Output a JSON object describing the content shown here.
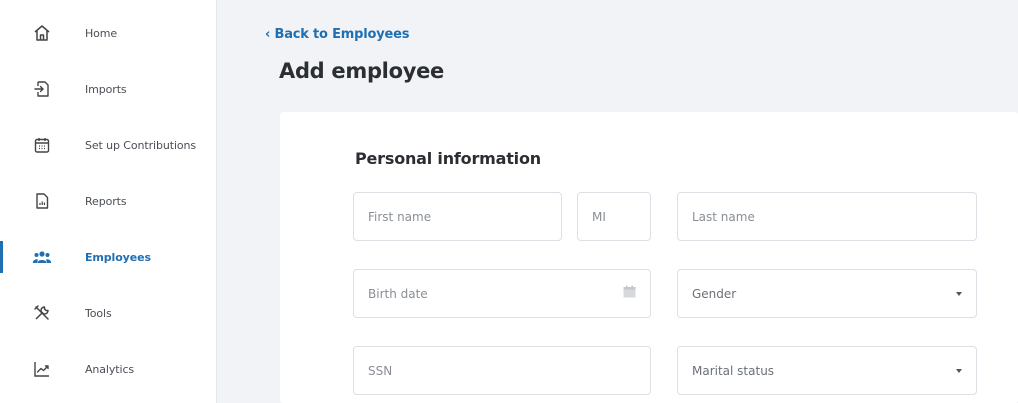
{
  "sidebar": {
    "items": [
      {
        "label": "Home",
        "icon": "home-icon",
        "active": false
      },
      {
        "label": "Imports",
        "icon": "import-icon",
        "active": false
      },
      {
        "label": "Set up Contributions",
        "icon": "calendar-icon",
        "active": false
      },
      {
        "label": "Reports",
        "icon": "report-icon",
        "active": false
      },
      {
        "label": "Employees",
        "icon": "people-icon",
        "active": true
      },
      {
        "label": "Tools",
        "icon": "tools-icon",
        "active": false
      },
      {
        "label": "Analytics",
        "icon": "analytics-icon",
        "active": false
      }
    ]
  },
  "header": {
    "back_link": "‹ Back to Employees",
    "title": "Add employee"
  },
  "form": {
    "section_title": "Personal information",
    "first_name": {
      "placeholder": "First name",
      "value": ""
    },
    "mi": {
      "placeholder": "MI",
      "value": ""
    },
    "last_name": {
      "placeholder": "Last name",
      "value": ""
    },
    "birth_date": {
      "placeholder": "Birth date",
      "value": "",
      "icon": "calendar-icon"
    },
    "gender": {
      "selected": "Gender",
      "icon": "chevron-down-icon"
    },
    "ssn": {
      "placeholder": "SSN",
      "value": ""
    },
    "marital_status": {
      "selected": "Marital status",
      "icon": "chevron-down-icon"
    }
  },
  "colors": {
    "accent": "#1f6fb2",
    "background": "#f1f3f6",
    "card": "#ffffff",
    "border": "#dcdfe3"
  }
}
